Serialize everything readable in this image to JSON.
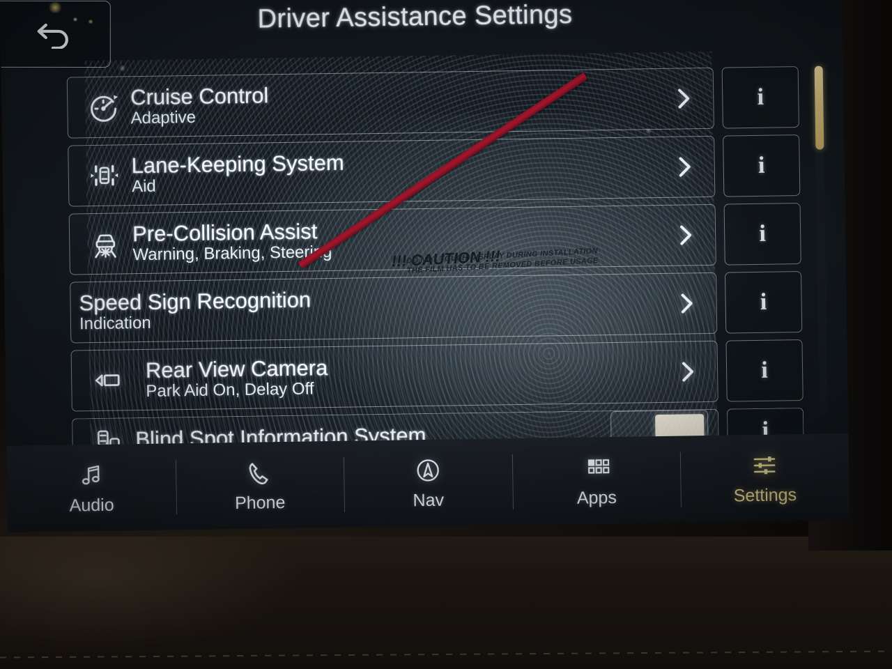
{
  "header": {
    "back_icon": "back-arrow-icon",
    "title": "Driver Assistance Settings"
  },
  "list": {
    "items": [
      {
        "icon": "cruise-control-gauge-icon",
        "title": "Cruise Control",
        "subtitle": "Adaptive",
        "chevron": "chevron-right-icon",
        "info": "i"
      },
      {
        "icon": "lane-keeping-icon",
        "title": "Lane-Keeping System",
        "subtitle": "Aid",
        "chevron": "chevron-right-icon",
        "info": "i"
      },
      {
        "icon": "pre-collision-icon",
        "title": "Pre-Collision Assist",
        "subtitle": "Warning, Braking, Steering",
        "chevron": "chevron-right-icon",
        "info": "i"
      },
      {
        "icon": "",
        "title": "Speed Sign Recognition",
        "subtitle": "Indication",
        "chevron": "chevron-right-icon",
        "info": "i"
      },
      {
        "icon": "rear-view-camera-icon",
        "title": "Rear View Camera",
        "subtitle": "Park Aid On, Delay Off",
        "chevron": "chevron-right-icon",
        "info": "i"
      },
      {
        "icon": "blind-spot-icon",
        "title": "Blind Spot Information System",
        "subtitle": "",
        "toggle_state": "on",
        "info": "i"
      }
    ]
  },
  "scrollbar": {
    "thumb_color": "#d8c07d"
  },
  "film_overlay": {
    "caution": "!!! CAUTION !!!",
    "line1": "DO NOT TOUCH DISPLAY DURING INSTALLATION",
    "line2": "THE FILM HAS TO BE REMOVED BEFORE USAGE",
    "strip_color": "#a4152c"
  },
  "navbar": {
    "items": [
      {
        "icon": "music-note-icon",
        "label": "Audio",
        "active": false
      },
      {
        "icon": "phone-handset-icon",
        "label": "Phone",
        "active": false
      },
      {
        "icon": "navigation-compass-icon",
        "label": "Nav",
        "active": false
      },
      {
        "icon": "apps-grid-icon",
        "label": "Apps",
        "active": false
      },
      {
        "icon": "sliders-settings-icon",
        "label": "Settings",
        "active": true
      }
    ],
    "active_color": "#e8dc96"
  }
}
